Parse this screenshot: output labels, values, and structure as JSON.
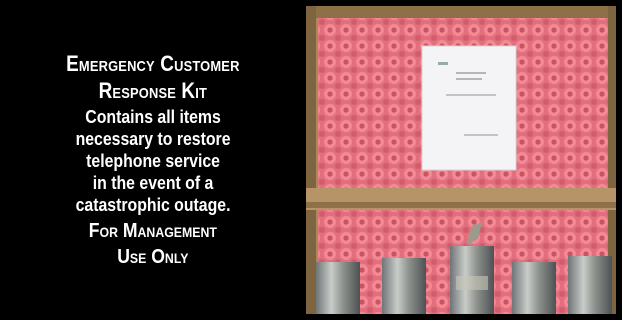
{
  "panel": {
    "title_line1": "Emergency Customer",
    "title_line2": "Response Kit",
    "body_lines": [
      "Contains all items",
      "necessary to restore",
      "telephone service",
      "in the event of a",
      "catastrophic outage."
    ],
    "footer_line1": "For Management",
    "footer_line2": "Use Only"
  },
  "colors": {
    "background": "#000000",
    "text": "#ffffff",
    "foam": "#e06a7a",
    "cardboard": "#b08f63"
  }
}
